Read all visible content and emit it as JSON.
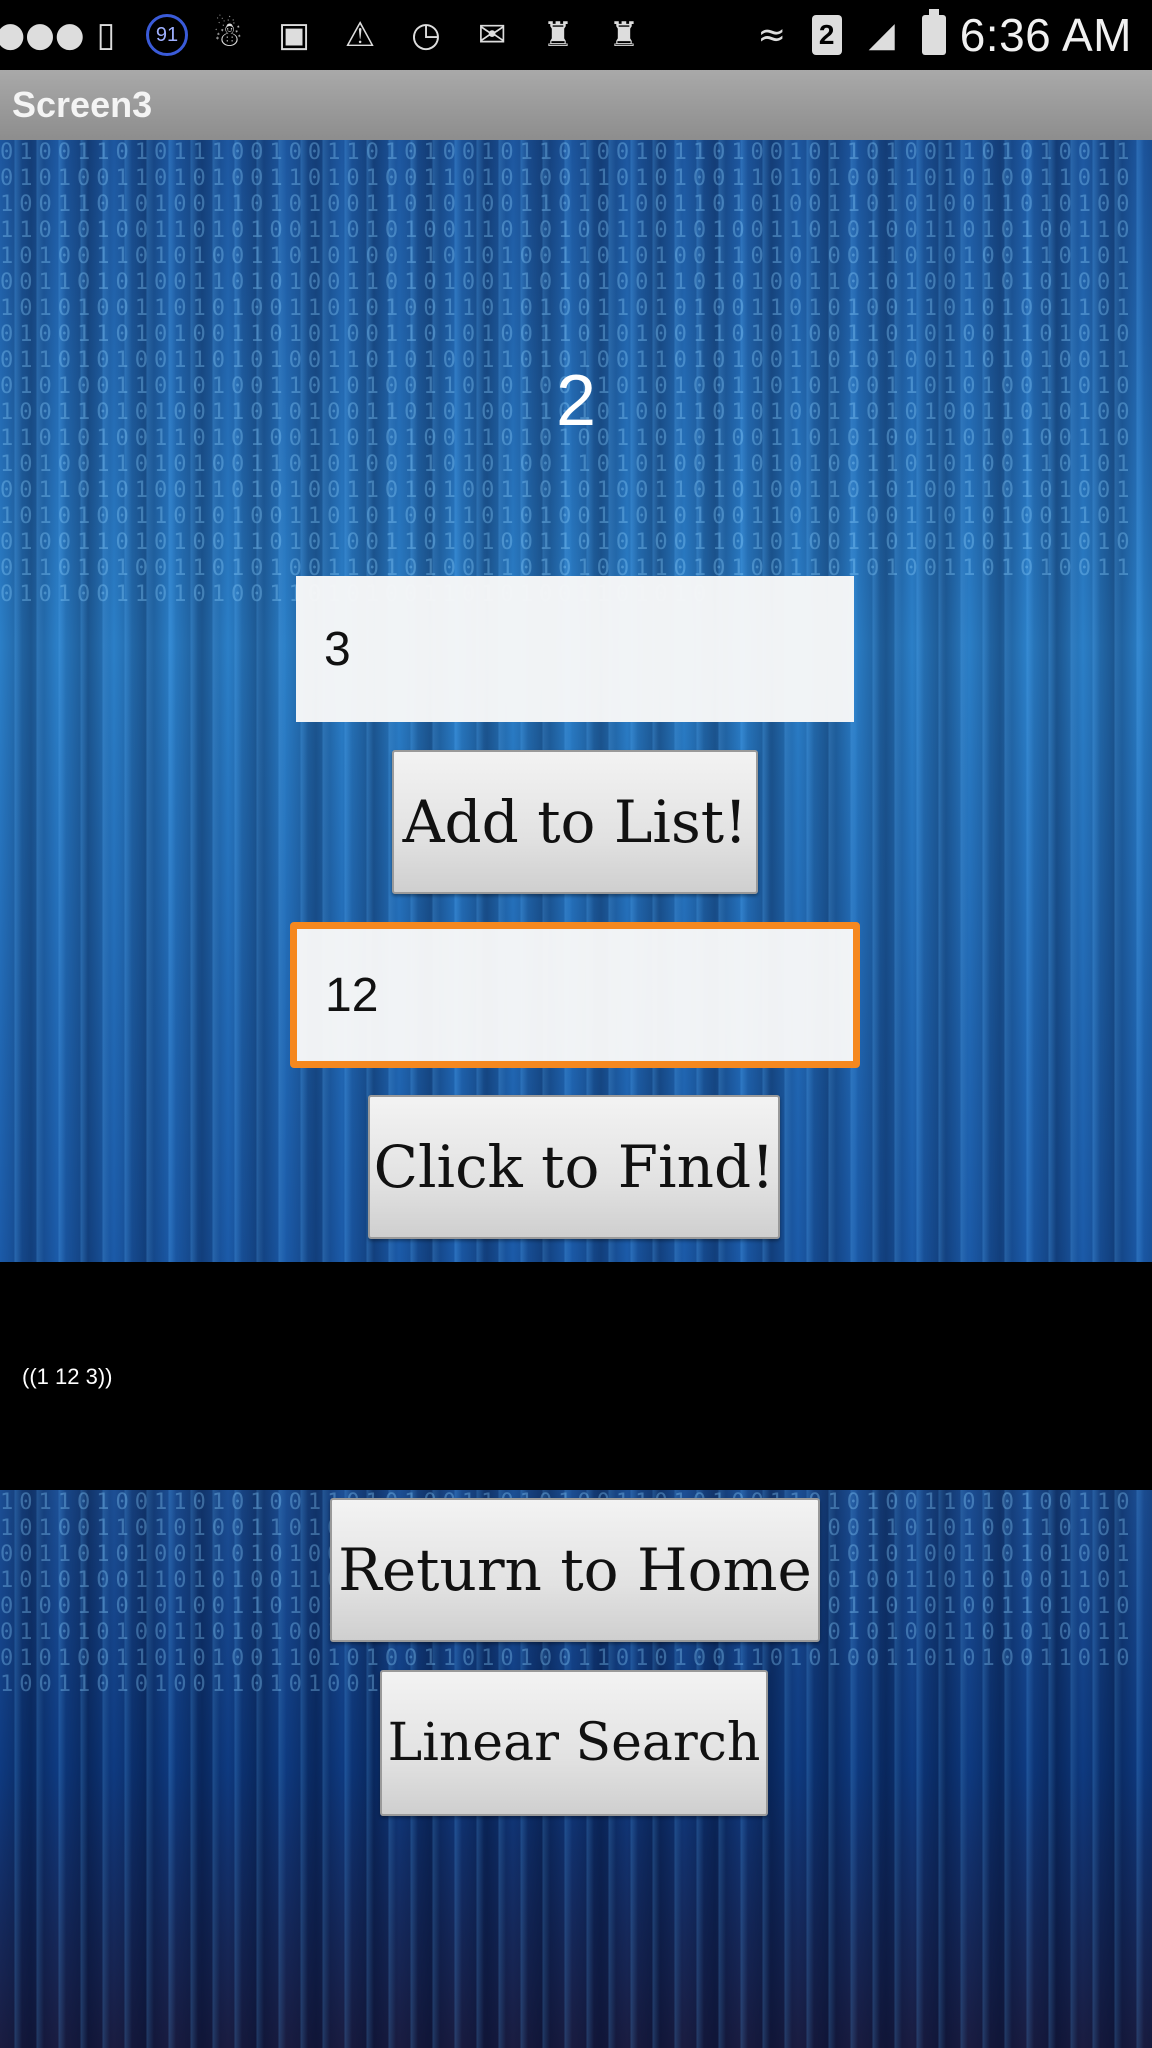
{
  "status_bar": {
    "time": "6:36 AM",
    "battery_badge": "91",
    "sim_slot": "2",
    "left_icons": [
      "message-icon",
      "device-icon",
      "battery-saver-badge-icon",
      "snapchat-icon",
      "image-icon",
      "warning-icon",
      "alarm-icon",
      "gmail-icon",
      "game-icon",
      "game-icon"
    ],
    "right_icons": [
      "wifi-icon",
      "sim-icon",
      "signal-icon",
      "battery-icon"
    ]
  },
  "title_bar": {
    "title": "Screen3"
  },
  "main": {
    "counter": "2",
    "input_add": {
      "value": "3"
    },
    "add_button_label": "Add to List!",
    "input_find": {
      "value": "12"
    },
    "find_button_label": "Click to Find!",
    "list_output": "((1 12 3))",
    "home_button_label": "Return to Home",
    "linear_button_label": "Linear Search"
  },
  "colors": {
    "focus_border": "#f5881f",
    "title_bar": "#9a9a9a",
    "background_blue": "#2b7fc7"
  }
}
